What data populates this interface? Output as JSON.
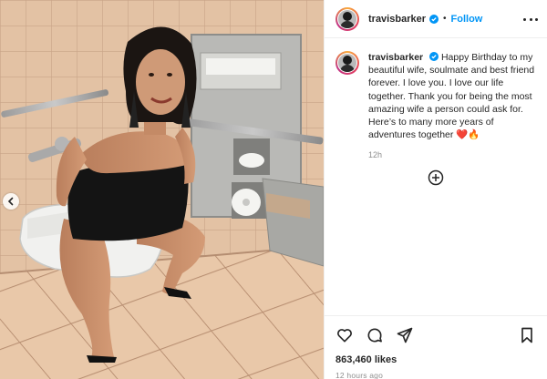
{
  "post": {
    "username": "travisbarker",
    "verified": true,
    "follow_label": "Follow",
    "separator": "•",
    "caption": "Happy Birthday to my beautiful wife, soulmate and best friend forever. I love you. I love our life together. Thank you for being the most amazing wife a person could ask for. Here’s to many more years of adventures together",
    "caption_emoji": "❤️🔥",
    "caption_time": "12h",
    "likes": "863,460 likes",
    "posted_ago": "12 hours ago"
  },
  "icons": {
    "more": "more-options-icon",
    "verified": "verified-badge-icon",
    "add": "add-circle-icon",
    "like": "heart-icon",
    "comment": "comment-icon",
    "share": "share-icon",
    "save": "bookmark-icon",
    "prev": "chevron-left-icon"
  },
  "colors": {
    "accent": "#0095f6",
    "text": "#262626",
    "muted": "#8e8e8e"
  }
}
